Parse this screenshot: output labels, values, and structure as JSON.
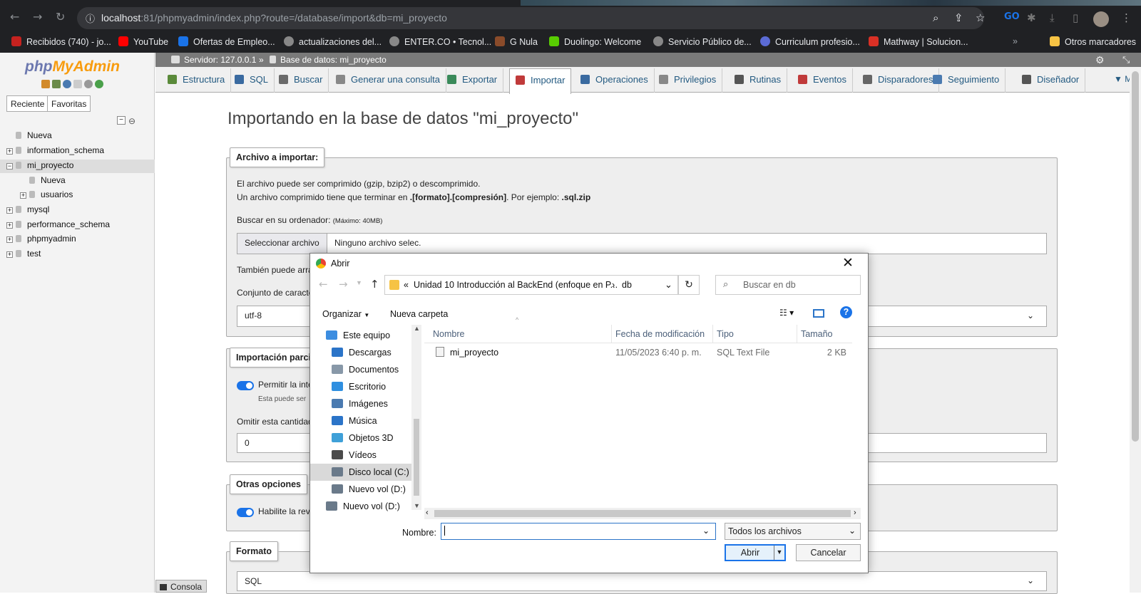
{
  "browser": {
    "url_host": "localhost",
    "url_rest": ":81/phpmyadmin/index.php?route=/database/import&db=mi_proyecto",
    "bookmarks": [
      {
        "label": "Recibidos (740) - jo...",
        "color": "#c5221f"
      },
      {
        "label": "YouTube",
        "color": "#ff0000"
      },
      {
        "label": "Ofertas de Empleo...",
        "color": "#1a73e8"
      },
      {
        "label": "actualizaciones del...",
        "color": "#888888"
      },
      {
        "label": "ENTER.CO • Tecnol...",
        "color": "#888888"
      },
      {
        "label": "G Nula",
        "color": "#8a4b2a"
      },
      {
        "label": "Duolingo: Welcome",
        "color": "#58cc02"
      },
      {
        "label": "Servicio Público de...",
        "color": "#888888"
      },
      {
        "label": "Curriculum profesio...",
        "color": "#5b6bd5"
      },
      {
        "label": "Mathway | Solucion...",
        "color": "#d93025"
      },
      {
        "label": "Otros marcadores",
        "color": "#f6c344"
      }
    ]
  },
  "sidebar": {
    "logo_php": "php",
    "logo_myadmin": "MyAdmin",
    "btn_recent": "Reciente",
    "btn_favorites": "Favoritas",
    "tree": [
      {
        "label": "Nueva",
        "level": 0,
        "expander": ""
      },
      {
        "label": "information_schema",
        "level": 0,
        "expander": "+"
      },
      {
        "label": "mi_proyecto",
        "level": 0,
        "expander": "−"
      },
      {
        "label": "Nueva",
        "level": 1,
        "expander": ""
      },
      {
        "label": "usuarios",
        "level": 1,
        "expander": "+"
      },
      {
        "label": "mysql",
        "level": 0,
        "expander": "+"
      },
      {
        "label": "performance_schema",
        "level": 0,
        "expander": "+"
      },
      {
        "label": "phpmyadmin",
        "level": 0,
        "expander": "+"
      },
      {
        "label": "test",
        "level": 0,
        "expander": "+"
      }
    ]
  },
  "server_bar": {
    "server": "Servidor: 127.0.0.1",
    "sep": "»",
    "database": "Base de datos: mi_proyecto"
  },
  "tabs": [
    {
      "label": "Estructura",
      "active": false
    },
    {
      "label": "SQL",
      "active": false
    },
    {
      "label": "Buscar",
      "active": false
    },
    {
      "label": "Generar una consulta",
      "active": false
    },
    {
      "label": "Exportar",
      "active": false
    },
    {
      "label": "Importar",
      "active": true
    },
    {
      "label": "Operaciones",
      "active": false
    },
    {
      "label": "Privilegios",
      "active": false
    },
    {
      "label": "Rutinas",
      "active": false
    },
    {
      "label": "Eventos",
      "active": false
    },
    {
      "label": "Disparadores",
      "active": false
    },
    {
      "label": "Seguimiento",
      "active": false
    },
    {
      "label": "Diseñador",
      "active": false
    }
  ],
  "main": {
    "title": "Importando en la base de datos \"mi_proyecto\"",
    "file_legend": "Archivo a importar:",
    "compress_line1": "El archivo puede ser comprimido (gzip, bzip2) o descomprimido.",
    "compress_line2_a": "Un archivo comprimido tiene que terminar en ",
    "compress_line2_b": ".[formato].[compresión]",
    "compress_line2_c": ". Por ejemplo: ",
    "compress_line2_d": ".sql.zip",
    "browse_label": "Buscar en su ordenador:",
    "browse_max": "(Máximo: 40MB)",
    "select_file_btn": "Seleccionar archivo",
    "no_file": "Ninguno archivo selec.",
    "also_drag": "También puede arra",
    "charset_label": "Conjunto de caracte",
    "charset_value": "utf-8",
    "partial_legend": "Importación parcia",
    "allow_interrupt": "Permitir la inte",
    "allow_interrupt_sub": "Esta puede ser",
    "skip_label": "Omitir esta cantidad",
    "skip_value": "0",
    "other_legend": "Otras opciones",
    "enable_check": "Habilite la rev",
    "format_legend": "Formato",
    "format_value": "SQL",
    "console": "Consola"
  },
  "dialog": {
    "title": "Abrir",
    "breadcrumb_prefix": "«",
    "breadcrumb_folder": "Unidad 10 Introducción al BackEnd (enfoque en P...",
    "breadcrumb_arrow": "›",
    "breadcrumb_sub": "db",
    "search_placeholder": "Buscar en db",
    "organize": "Organizar",
    "new_folder": "Nueva carpeta",
    "nav_items": [
      {
        "label": "Este equipo",
        "icon": "computer-icon",
        "color": "#3c8de0"
      },
      {
        "label": "Descargas",
        "icon": "download-icon",
        "color": "#2b74c8"
      },
      {
        "label": "Documentos",
        "icon": "document-icon",
        "color": "#8898a8"
      },
      {
        "label": "Escritorio",
        "icon": "desktop-icon",
        "color": "#2f8fe0"
      },
      {
        "label": "Imágenes",
        "icon": "image-icon",
        "color": "#4a7ab0"
      },
      {
        "label": "Música",
        "icon": "music-icon",
        "color": "#2b74c8"
      },
      {
        "label": "Objetos 3D",
        "icon": "cube-icon",
        "color": "#3fa0d8"
      },
      {
        "label": "Vídeos",
        "icon": "video-icon",
        "color": "#4a4a4a"
      },
      {
        "label": "Disco local (C:)",
        "icon": "drive-icon",
        "color": "#6a7a8a"
      },
      {
        "label": "Nuevo vol (D:)",
        "icon": "drive-icon",
        "color": "#6a7a8a"
      },
      {
        "label": "Nuevo vol (D:)",
        "icon": "drive-icon",
        "color": "#6a7a8a"
      }
    ],
    "columns": [
      "Nombre",
      "Fecha de modificación",
      "Tipo",
      "Tamaño"
    ],
    "files": [
      {
        "name": "mi_proyecto",
        "modified": "11/05/2023 6:40 p. m.",
        "type": "SQL Text File",
        "size": "2 KB"
      }
    ],
    "filename_label": "Nombre:",
    "filename_value": "",
    "filter": "Todos los archivos",
    "open_btn": "Abrir",
    "cancel_btn": "Cancelar"
  }
}
